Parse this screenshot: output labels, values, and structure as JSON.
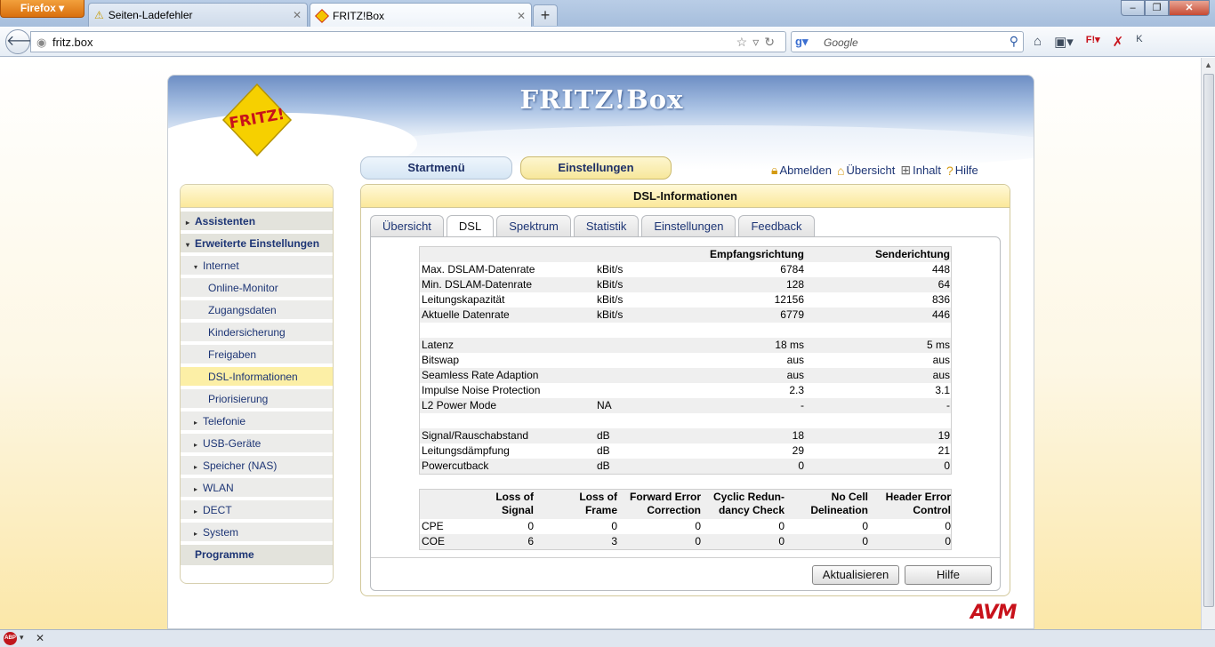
{
  "browser": {
    "menu_button": "Firefox ▾",
    "tabs": [
      {
        "label": "Seiten-Ladefehler",
        "icon": "warning-icon"
      },
      {
        "label": "FRITZ!Box",
        "icon": "fritz-favicon"
      }
    ],
    "new_tab": "+",
    "url": "fritz.box",
    "search_placeholder": "Google",
    "window_controls": [
      "–",
      "❐",
      "✕"
    ]
  },
  "fritzbox": {
    "brand_title": "FRITZ!Box",
    "logo_text": "FRITZ!",
    "nav": {
      "start": "Startmenü",
      "settings": "Einstellungen"
    },
    "top_links": {
      "logout": "Abmelden",
      "overview": "Übersicht",
      "content": "Inhalt",
      "help": "Hilfe"
    },
    "sidebar": {
      "items": [
        {
          "label": "Assistenten",
          "arrow": "▸"
        },
        {
          "label": "Erweiterte Einstellungen",
          "arrow": "▾"
        },
        {
          "label": "Internet",
          "arrow": "▾"
        },
        {
          "label": "Online-Monitor"
        },
        {
          "label": "Zugangsdaten"
        },
        {
          "label": "Kindersicherung"
        },
        {
          "label": "Freigaben"
        },
        {
          "label": "DSL-Informationen"
        },
        {
          "label": "Priorisierung"
        },
        {
          "label": "Telefonie",
          "arrow": "▸"
        },
        {
          "label": "USB-Geräte",
          "arrow": "▸"
        },
        {
          "label": "Speicher (NAS)",
          "arrow": "▸"
        },
        {
          "label": "WLAN",
          "arrow": "▸"
        },
        {
          "label": "DECT",
          "arrow": "▸"
        },
        {
          "label": "System",
          "arrow": "▸"
        },
        {
          "label": "Programme"
        }
      ]
    },
    "panel": {
      "title": "DSL-Informationen",
      "tabs": [
        "Übersicht",
        "DSL",
        "Spektrum",
        "Statistik",
        "Einstellungen",
        "Feedback"
      ],
      "active_tab": "DSL",
      "table1": {
        "headers": {
          "rx": "Empfangsrichtung",
          "tx": "Senderichtung"
        },
        "rows": [
          {
            "label": "Max. DSLAM-Datenrate",
            "unit": "kBit/s",
            "rx": "6784",
            "tx": "448"
          },
          {
            "label": "Min. DSLAM-Datenrate",
            "unit": "kBit/s",
            "rx": "128",
            "tx": "64"
          },
          {
            "label": "Leitungskapazität",
            "unit": "kBit/s",
            "rx": "12156",
            "tx": "836"
          },
          {
            "label": "Aktuelle Datenrate",
            "unit": "kBit/s",
            "rx": "6779",
            "tx": "446"
          },
          {
            "label": "",
            "unit": "",
            "rx": "",
            "tx": ""
          },
          {
            "label": "Latenz",
            "unit": "",
            "rx": "18 ms",
            "tx": "5 ms"
          },
          {
            "label": "Bitswap",
            "unit": "",
            "rx": "aus",
            "tx": "aus"
          },
          {
            "label": "Seamless Rate Adaption",
            "unit": "",
            "rx": "aus",
            "tx": "aus"
          },
          {
            "label": "Impulse Noise Protection",
            "unit": "",
            "rx": "2.3",
            "tx": "3.1"
          },
          {
            "label": "L2 Power Mode",
            "unit": "NA",
            "rx": "-",
            "tx": "-"
          },
          {
            "label": "",
            "unit": "",
            "rx": "",
            "tx": ""
          },
          {
            "label": "Signal/Rauschabstand",
            "unit": "dB",
            "rx": "18",
            "tx": "19"
          },
          {
            "label": "Leitungsdämpfung",
            "unit": "dB",
            "rx": "29",
            "tx": "21"
          },
          {
            "label": "Powercutback",
            "unit": "dB",
            "rx": "0",
            "tx": "0"
          }
        ]
      },
      "table2": {
        "headers": [
          [
            "Loss of",
            "Signal"
          ],
          [
            "Loss of",
            "Frame"
          ],
          [
            "Forward Error",
            "Correction"
          ],
          [
            "Cyclic Redun-",
            "dancy Check"
          ],
          [
            "No Cell",
            "Delineation"
          ],
          [
            "Header Error",
            "Control"
          ]
        ],
        "rows": [
          {
            "label": "CPE",
            "values": [
              "0",
              "0",
              "0",
              "0",
              "0",
              "0"
            ]
          },
          {
            "label": "COE",
            "values": [
              "6",
              "3",
              "0",
              "0",
              "0",
              "0"
            ]
          }
        ]
      },
      "buttons": {
        "refresh": "Aktualisieren",
        "help": "Hilfe"
      }
    },
    "footer_logo": "AVM"
  },
  "colors": {
    "accent_yellow": "#fbe89a",
    "link_blue": "#1d3575",
    "fritz_red": "#c8121b"
  }
}
